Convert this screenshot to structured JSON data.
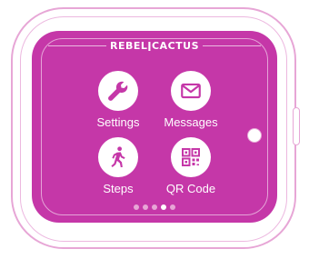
{
  "device": {
    "brand": "REBEL",
    "brand_suffix": "CACTUS",
    "brand_divider": "ǀ"
  },
  "apps": [
    {
      "label": "Settings",
      "icon": "wrench-icon"
    },
    {
      "label": "Messages",
      "icon": "envelope-icon"
    },
    {
      "label": "Steps",
      "icon": "walking-person-icon"
    },
    {
      "label": "QR Code",
      "icon": "qr-code-icon"
    }
  ],
  "pagination": {
    "total": 5,
    "active_index": 3
  },
  "colors": {
    "screen": "#c537a8",
    "case_outline": "#e7a6d6",
    "icon_fill": "#c537a8",
    "text": "#ffffff"
  }
}
